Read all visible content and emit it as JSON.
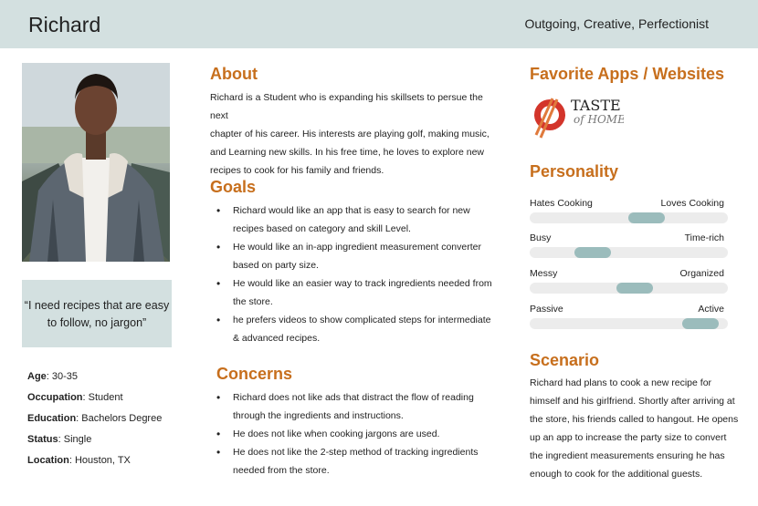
{
  "header": {
    "name": "Richard",
    "traits": "Outgoing, Creative, Perfectionist"
  },
  "quote": "“I need recipes that are easy to follow, no jargon”",
  "facts": [
    {
      "label": "Age",
      "value": ": 30-35"
    },
    {
      "label": "Occupation",
      "value": ": Student"
    },
    {
      "label": "Education",
      "value": ": Bachelors Degree"
    },
    {
      "label": "Status",
      "value": ": Single"
    },
    {
      "label": "Location",
      "value": ": Houston, TX"
    }
  ],
  "about": {
    "title": "About",
    "lines": [
      "Richard is a Student who is expanding his skillsets to persue the next",
      "chapter of his career.  His interests are playing golf, making music,",
      "and  Learning new skills. In his free time, he loves to explore new",
      "recipes to cook for his family and friends."
    ]
  },
  "goals": {
    "title": "Goals",
    "items": [
      [
        "Richard would like an app that is easy to search for new",
        "recipes based on category and skill Level."
      ],
      [
        "He would like an in-app ingredient measurement converter",
        "based on party size."
      ],
      [
        "He would like an easier way to track ingredients needed from",
        "the store."
      ],
      [
        "he prefers videos to show complicated steps for intermediate",
        "& advanced recipes."
      ]
    ]
  },
  "concerns": {
    "title": "Concerns",
    "items": [
      [
        "Richard does not like ads that distract the flow of reading",
        "through the ingredients and instructions."
      ],
      [
        "He does not like when cooking jargons are used."
      ],
      [
        "He does not like the 2-step method of tracking ingredients",
        "needed from the store."
      ]
    ]
  },
  "favorites": {
    "title": "Favorite Apps / Websites",
    "logo_word1": "TASTE",
    "logo_word2": "of HOME",
    "logo_accent": "#d3352b"
  },
  "personality": {
    "title": "Personality",
    "scales": [
      {
        "left": "Hates Cooking",
        "right": "Loves Cooking",
        "level": 0.59
      },
      {
        "left": "Busy",
        "right": "Time-rich",
        "level": 0.32
      },
      {
        "left": "Messy",
        "right": "Organized",
        "level": 0.53
      },
      {
        "left": "Passive",
        "right": "Active",
        "level": 0.86
      }
    ]
  },
  "scenario": {
    "title": "Scenario",
    "lines": [
      "Richard had plans to cook a new recipe for",
      "himself and his girlfriend. Shortly after arriving at",
      "the store, his friends called to hangout. He opens",
      "up an app to increase the party size to convert",
      "the ingredient measurements ensuring he has",
      "enough to cook for the additional guests."
    ]
  },
  "colors": {
    "accent": "#c76f1d",
    "panel": "#d3e0e0",
    "slider": "#9bbcbc"
  }
}
